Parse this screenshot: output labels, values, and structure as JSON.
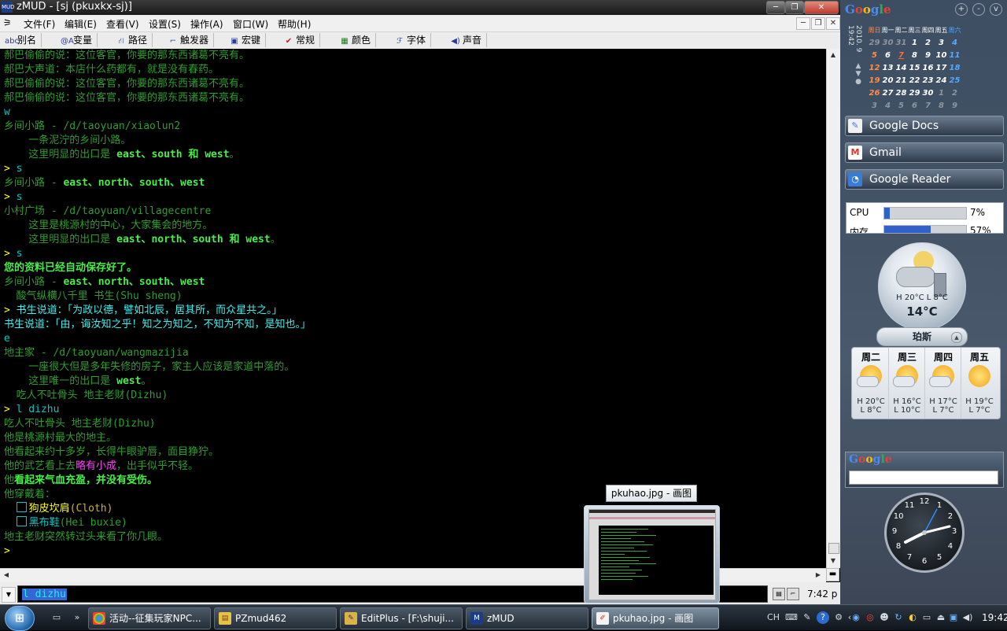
{
  "window": {
    "title": "zMUD - [sj (pkuxkx-sj)]",
    "icon": "zmud-app-icon",
    "controls": [
      "minimize",
      "restore",
      "close"
    ]
  },
  "menubar": {
    "items": [
      "文件(F)",
      "编辑(E)",
      "查看(V)",
      "设置(S)",
      "操作(A)",
      "窗口(W)",
      "帮助(H)"
    ],
    "mdi_controls": [
      "minimize",
      "restore",
      "close"
    ]
  },
  "toolbar": {
    "buttons": [
      {
        "icon": "abc",
        "label": "别名"
      },
      {
        "icon": "@A",
        "label": "变量"
      },
      {
        "icon": "path-icon",
        "label": "路径"
      },
      {
        "icon": "trigger-icon",
        "label": "触发器"
      },
      {
        "icon": "macro-icon",
        "label": "宏键"
      },
      {
        "icon": "check-icon",
        "label": "常规"
      },
      {
        "icon": "color-grid-icon",
        "label": "颜色"
      },
      {
        "icon": "font-icon",
        "label": "字体"
      },
      {
        "icon": "speaker-icon",
        "label": "声音"
      }
    ]
  },
  "output": {
    "lines": [
      {
        "segs": [
          {
            "t": "郝巴偷偷的说：这位客官，你要的那东西诸葛不亮有。",
            "c": "g"
          }
        ]
      },
      {
        "segs": [
          {
            "t": "郝巴大声道：本店什么药都有，就是没有春药。",
            "c": "g"
          }
        ]
      },
      {
        "segs": [
          {
            "t": "郝巴偷偷的说：这位客官，你要的那东西诸葛不亮有。",
            "c": "g"
          }
        ]
      },
      {
        "segs": [
          {
            "t": "郝巴偷偷的说：这位客官，你要的那东西诸葛不亮有。",
            "c": "g"
          }
        ]
      },
      {
        "segs": [
          {
            "t": "w",
            "c": "c"
          }
        ]
      },
      {
        "segs": [
          {
            "t": "乡间小路 - /d/taoyuan/xiaolun2",
            "c": "g"
          }
        ]
      },
      {
        "segs": [
          {
            "t": "    一条泥泞的乡间小路。",
            "c": "g"
          }
        ]
      },
      {
        "segs": [
          {
            "t": "    这里明显的出口是 ",
            "c": "g"
          },
          {
            "t": "east、south 和 west",
            "c": "gb"
          },
          {
            "t": "。",
            "c": "g"
          }
        ]
      },
      {
        "segs": [
          {
            "t": "> ",
            "c": "y"
          },
          {
            "t": "s",
            "c": "c"
          }
        ]
      },
      {
        "segs": [
          {
            "t": "乡间小路 - ",
            "c": "g"
          },
          {
            "t": "east、north、south、west",
            "c": "gb"
          }
        ]
      },
      {
        "segs": [
          {
            "t": "> ",
            "c": "y"
          },
          {
            "t": "s",
            "c": "c"
          }
        ]
      },
      {
        "segs": [
          {
            "t": "小村广场 - /d/taoyuan/villagecentre",
            "c": "g"
          }
        ]
      },
      {
        "segs": [
          {
            "t": "    这里是桃源村的中心，大家集会的地方。",
            "c": "g"
          }
        ]
      },
      {
        "segs": [
          {
            "t": "    这里明显的出口是 ",
            "c": "g"
          },
          {
            "t": "east、north、south 和 west",
            "c": "gb"
          },
          {
            "t": "。",
            "c": "g"
          }
        ]
      },
      {
        "segs": [
          {
            "t": "> ",
            "c": "y"
          },
          {
            "t": "s",
            "c": "c"
          }
        ]
      },
      {
        "segs": [
          {
            "t": "您的资料已经自动保存好了。",
            "c": "gb"
          }
        ]
      },
      {
        "segs": [
          {
            "t": "乡间小路 - ",
            "c": "g"
          },
          {
            "t": "east、north、south、west",
            "c": "gb"
          }
        ]
      },
      {
        "segs": [
          {
            "t": "  酸气纵横八千里 书生(Shu sheng)",
            "c": "g"
          }
        ]
      },
      {
        "segs": [
          {
            "t": "> ",
            "c": "y"
          },
          {
            "t": "书生说道：「为政以德，譬如北辰，居其所，而众星共之。」",
            "c": "cb"
          }
        ]
      },
      {
        "segs": [
          {
            "t": "书生说道：「由，诲汝知之乎！知之为知之，不知为不知，是知也。」",
            "c": "cb"
          }
        ]
      },
      {
        "segs": [
          {
            "t": "e",
            "c": "c"
          }
        ]
      },
      {
        "segs": [
          {
            "t": "地主家 - /d/taoyuan/wangmazijia",
            "c": "g"
          }
        ]
      },
      {
        "segs": [
          {
            "t": "    一座很大但是多年失修的房子，家主人应该是家道中落的。",
            "c": "g"
          }
        ]
      },
      {
        "segs": [
          {
            "t": "    这里唯一的出口是 ",
            "c": "g"
          },
          {
            "t": "west",
            "c": "gb"
          },
          {
            "t": "。",
            "c": "g"
          }
        ]
      },
      {
        "segs": [
          {
            "t": "  吃人不吐骨头 地主老财(Dizhu)",
            "c": "g"
          }
        ]
      },
      {
        "segs": [
          {
            "t": "> ",
            "c": "y"
          },
          {
            "t": "l dizhu",
            "c": "c"
          }
        ]
      },
      {
        "segs": [
          {
            "t": "吃人不吐骨头 地主老财(Dizhu)",
            "c": "g"
          }
        ]
      },
      {
        "segs": [
          {
            "t": "他是桃源村最大的地主。",
            "c": "g"
          }
        ]
      },
      {
        "segs": [
          {
            "t": "他看起来约十多岁，长得牛眼驴唇，面目狰狞。",
            "c": "g"
          }
        ]
      },
      {
        "segs": [
          {
            "t": "他的武艺看上去",
            "c": "g"
          },
          {
            "t": "略有小成",
            "c": "m"
          },
          {
            "t": "，出手似乎不轻。",
            "c": "g"
          }
        ]
      },
      {
        "segs": [
          {
            "t": "他",
            "c": "g"
          },
          {
            "t": "看起来气血充盈，并没有受伤。",
            "c": "gb"
          }
        ]
      },
      {
        "segs": [
          {
            "t": "他穿戴着：",
            "c": "g"
          }
        ]
      },
      {
        "segs": [
          {
            "t": "  ",
            "c": "g"
          },
          {
            "t": "[]",
            "c": "box"
          },
          {
            "t": "狗皮坎肩",
            "c": "y"
          },
          {
            "t": "(Cloth)",
            "c": "o"
          }
        ]
      },
      {
        "segs": [
          {
            "t": "  ",
            "c": "g"
          },
          {
            "t": "[]",
            "c": "box"
          },
          {
            "t": "黑布鞋",
            "c": "c"
          },
          {
            "t": "(Hei buxie)",
            "c": "g"
          }
        ]
      },
      {
        "segs": [
          {
            "t": "地主老财突然转过头来看了你几眼。",
            "c": "g"
          }
        ]
      },
      {
        "segs": [
          {
            "t": ">",
            "c": "y"
          }
        ]
      }
    ]
  },
  "command": {
    "value": "l dizhu",
    "status_time": "7:42 p"
  },
  "sidebar": {
    "brand": "Google",
    "controls": [
      "+",
      "-",
      "v"
    ],
    "calendar": {
      "side_label": "2010. 9",
      "side_time": "19:42",
      "weekdays": [
        "周日",
        "周一",
        "周二",
        "周三",
        "周四",
        "周五",
        "周六"
      ],
      "weeks": [
        [
          "29",
          "30",
          "31",
          "1",
          "2",
          "3",
          "4"
        ],
        [
          "5",
          "6",
          "7",
          "8",
          "9",
          "10",
          "11"
        ],
        [
          "12",
          "13",
          "14",
          "15",
          "16",
          "17",
          "18"
        ],
        [
          "19",
          "20",
          "21",
          "22",
          "23",
          "24",
          "25"
        ],
        [
          "26",
          "27",
          "28",
          "29",
          "30",
          "1",
          "2"
        ],
        [
          "3",
          "4",
          "5",
          "6",
          "7",
          "8",
          "9"
        ]
      ],
      "today": "7"
    },
    "apps": [
      {
        "label": "Google Docs",
        "icon": "google-docs-icon"
      },
      {
        "label": "Gmail",
        "icon": "gmail-icon"
      },
      {
        "label": "Google Reader",
        "icon": "google-reader-icon"
      }
    ],
    "cpu": {
      "label": "CPU",
      "value": 0.07,
      "pct": "7%"
    },
    "mem": {
      "label": "内存",
      "value": 0.57,
      "pct": "57%"
    },
    "weather": {
      "hilo": "H 20°C L 8°C",
      "temp": "14°C",
      "city": "珀斯",
      "forecast": [
        {
          "day": "周二",
          "hi": "H 20°C",
          "lo": "L 8°C",
          "icon": "partly-cloudy-icon"
        },
        {
          "day": "周三",
          "hi": "H 16°C",
          "lo": "L 10°C",
          "icon": "partly-cloudy-icon"
        },
        {
          "day": "周四",
          "hi": "H 17°C",
          "lo": "L 7°C",
          "icon": "partly-cloudy-icon"
        },
        {
          "day": "周五",
          "hi": "H 19°C",
          "lo": "L 7°C",
          "icon": "sunny-icon"
        }
      ]
    },
    "search_brand": "Google",
    "clock": {
      "numbers": [
        "12",
        "1",
        "2",
        "3",
        "4",
        "5",
        "6",
        "7",
        "8",
        "9",
        "10",
        "11"
      ]
    }
  },
  "thumbnail": {
    "tooltip": "pkuhao.jpg - 画图"
  },
  "taskbar": {
    "items": [
      {
        "label": "活动--征集玩家NPC...",
        "icon": "chrome-icon",
        "active": false
      },
      {
        "label": "PZmud462",
        "icon": "folder-icon",
        "active": false
      },
      {
        "label": "EditPlus - [F:\\shuji...",
        "icon": "editplus-icon",
        "active": false
      },
      {
        "label": "zMUD",
        "icon": "zmud-icon",
        "active": false
      },
      {
        "label": "pkuhao.jpg - 画图",
        "icon": "paint-icon",
        "active": true
      }
    ],
    "lang": "CH",
    "time": "19:42"
  },
  "colors": {
    "output_bg": "#000000",
    "green": "#2e9e2e",
    "bright_green": "#46ef46",
    "cyan": "#00c8c8",
    "yellow": "#ffff00",
    "magenta": "#ff3cff"
  }
}
